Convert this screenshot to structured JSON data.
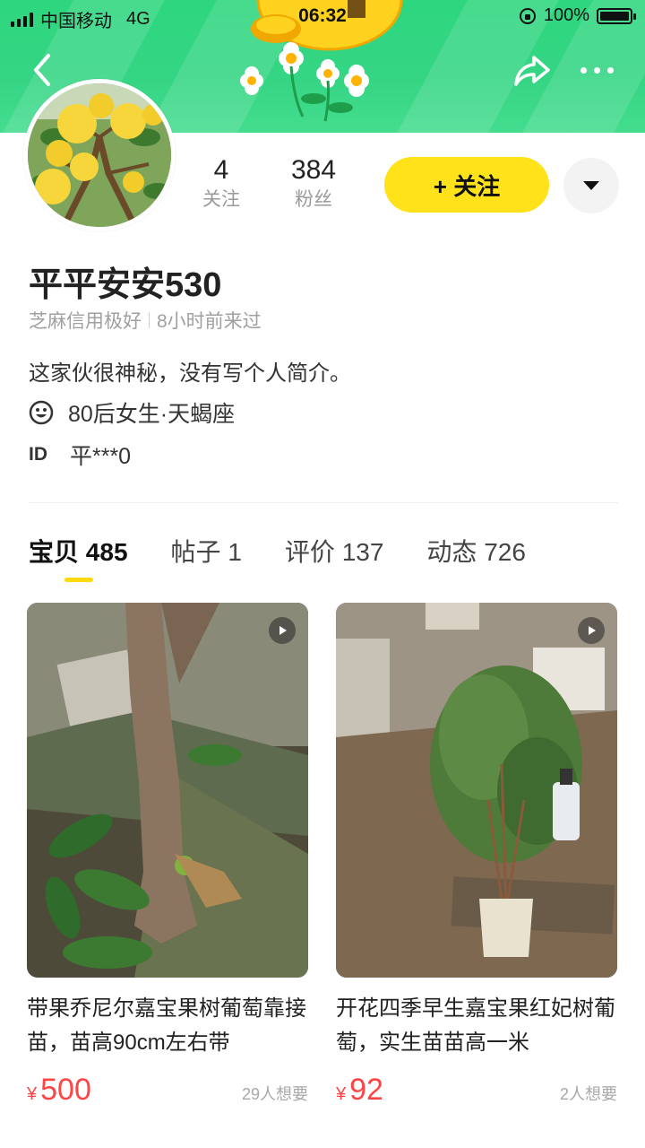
{
  "status_bar": {
    "carrier": "中国移动",
    "network": "4G",
    "time": "06:32",
    "battery": "100%"
  },
  "profile": {
    "following_count": "4",
    "following_label": "关注",
    "followers_count": "384",
    "followers_label": "粉丝",
    "follow_button_label": "+ 关注",
    "username": "平平安安530",
    "credit": "芝麻信用极好",
    "last_seen": "8小时前来过",
    "bio": "这家伙很神秘，没有写个人简介。",
    "demographics": "80后女生·天蝎座",
    "id_label": "ID",
    "id_value": "平***0"
  },
  "tabs": [
    {
      "label": "宝贝",
      "count": "485",
      "active": true
    },
    {
      "label": "帖子",
      "count": "1",
      "active": false
    },
    {
      "label": "评价",
      "count": "137",
      "active": false
    },
    {
      "label": "动态",
      "count": "726",
      "active": false
    }
  ],
  "listings": [
    {
      "title": "带果乔尼尔嘉宝果树葡萄靠接苗，苗高90cm左右带",
      "currency": "¥",
      "price": "500",
      "wants": "29人想要"
    },
    {
      "title": "开花四季早生嘉宝果红妃树葡萄，实生苗苗高一米",
      "currency": "¥",
      "price": "92",
      "wants": "2人想要"
    }
  ],
  "colors": {
    "banner_green": "#35d584",
    "accent_yellow": "#ffe21a",
    "price_red": "#ff4444"
  },
  "icons": [
    "back-icon",
    "share-icon",
    "more-icon",
    "dropdown-icon",
    "smiley-icon",
    "video-icon",
    "signal-icon",
    "battery-icon"
  ]
}
